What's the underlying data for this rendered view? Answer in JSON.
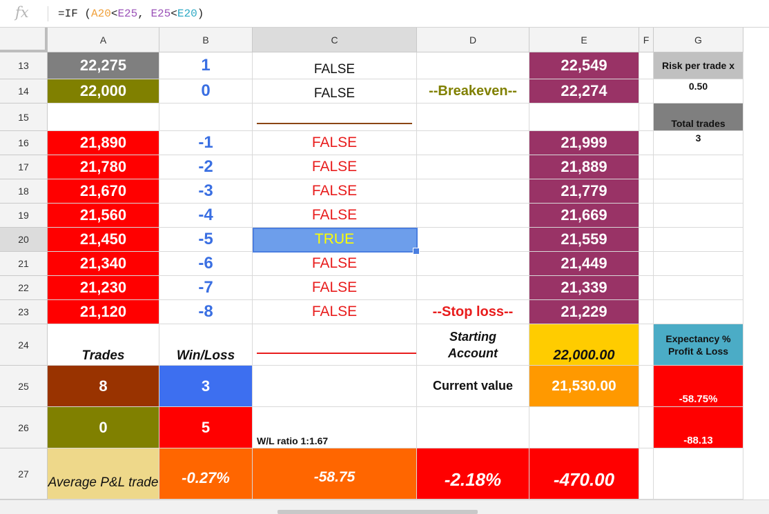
{
  "formula": {
    "fx_label": "fx",
    "prefix": "=IF (",
    "ref1": "A20",
    "op1": "<",
    "ref2": "E25",
    "sep": ", ",
    "ref3": "E25",
    "op2": "<",
    "ref4": "E20",
    "suffix": ")"
  },
  "columns": [
    "A",
    "B",
    "C",
    "D",
    "E",
    "F",
    "G"
  ],
  "rows": [
    "13",
    "14",
    "15",
    "16",
    "17",
    "18",
    "19",
    "20",
    "21",
    "22",
    "23",
    "24",
    "25",
    "26",
    "27"
  ],
  "selected_column": "C",
  "selected_row": "20",
  "colors": {
    "gray": "#7f7f7f",
    "olive": "#808000",
    "red": "#ff0000",
    "plum": "#993366",
    "blue_cell": "#3d6ff0",
    "brown": "#993300",
    "yellow": "#ffcc00",
    "orange": "#ff9900",
    "dark_orange": "#ff6600",
    "light_gray": "#c0c0c0",
    "teal": "#4bacc6",
    "khaki": "#eed88a",
    "selected_fill": "#6d9eeb",
    "true_text": "#ffff00"
  },
  "cells": {
    "A13": "22,275",
    "B13": "1",
    "C13": "FALSE",
    "D13": "",
    "E13": "22,549",
    "G13": "Risk per trade x",
    "A14": "22,000",
    "B14": "0",
    "C14": "FALSE",
    "D14": "--Breakeven--",
    "E14": "22,274",
    "G14": "0.50",
    "G15": "Total trades",
    "A16": "21,890",
    "B16": "-1",
    "C16": "FALSE",
    "E16": "21,999",
    "G16": "3",
    "A17": "21,780",
    "B17": "-2",
    "C17": "FALSE",
    "E17": "21,889",
    "A18": "21,670",
    "B18": "-3",
    "C18": "FALSE",
    "E18": "21,779",
    "A19": "21,560",
    "B19": "-4",
    "C19": "FALSE",
    "E19": "21,669",
    "A20": "21,450",
    "B20": "-5",
    "C20": "TRUE",
    "E20": "21,559",
    "A21": "21,340",
    "B21": "-6",
    "C21": "FALSE",
    "E21": "21,449",
    "A22": "21,230",
    "B22": "-7",
    "C22": "FALSE",
    "E22": "21,339",
    "A23": "21,120",
    "B23": "-8",
    "C23": "FALSE",
    "D23": "--Stop loss--",
    "E23": "21,229",
    "A24": "Trades",
    "B24": "Win/Loss",
    "D24": "Starting Account",
    "E24": "22,000.00",
    "G24": "Expectancy % Profit & Loss",
    "A25": "8",
    "B25": "3",
    "D25": "Current value",
    "E25": "21,530.00",
    "G25": "-58.75%",
    "A26": "0",
    "B26": "5",
    "C26": "W/L ratio  1:1.67",
    "G26": "-88.13",
    "A27": "Average P&L trade",
    "B27": "-0.27%",
    "C27": "-58.75",
    "D27": "-2.18%",
    "E27": "-470.00"
  }
}
